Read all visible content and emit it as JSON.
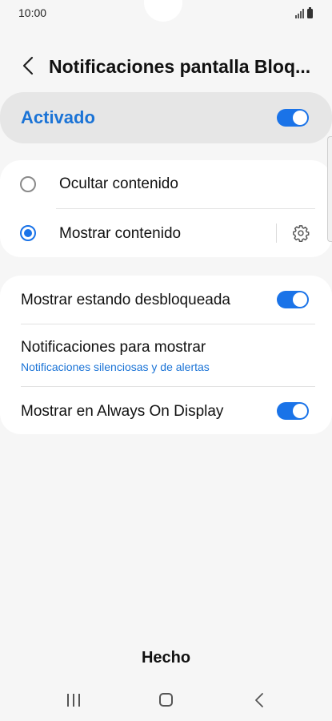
{
  "status_bar": {
    "time": "10:00"
  },
  "header": {
    "title": "Notificaciones pantalla Bloq..."
  },
  "master": {
    "label": "Activado",
    "enabled": true
  },
  "content_options": [
    {
      "label": "Ocultar contenido",
      "selected": false
    },
    {
      "label": "Mostrar contenido",
      "selected": true,
      "icon": "gear-icon"
    }
  ],
  "settings": {
    "show_unlocked": {
      "label": "Mostrar estando desbloqueada",
      "enabled": true
    },
    "notifications_to_show": {
      "label": "Notificaciones para mostrar",
      "value": "Notificaciones silenciosas y de alertas"
    },
    "always_on_display": {
      "label": "Mostrar en Always On Display",
      "enabled": true
    }
  },
  "footer": {
    "done_label": "Hecho"
  },
  "colors": {
    "accent": "#1a73e8",
    "background": "#f6f6f6",
    "card": "#ffffff",
    "master_card": "#e6e6e6"
  }
}
